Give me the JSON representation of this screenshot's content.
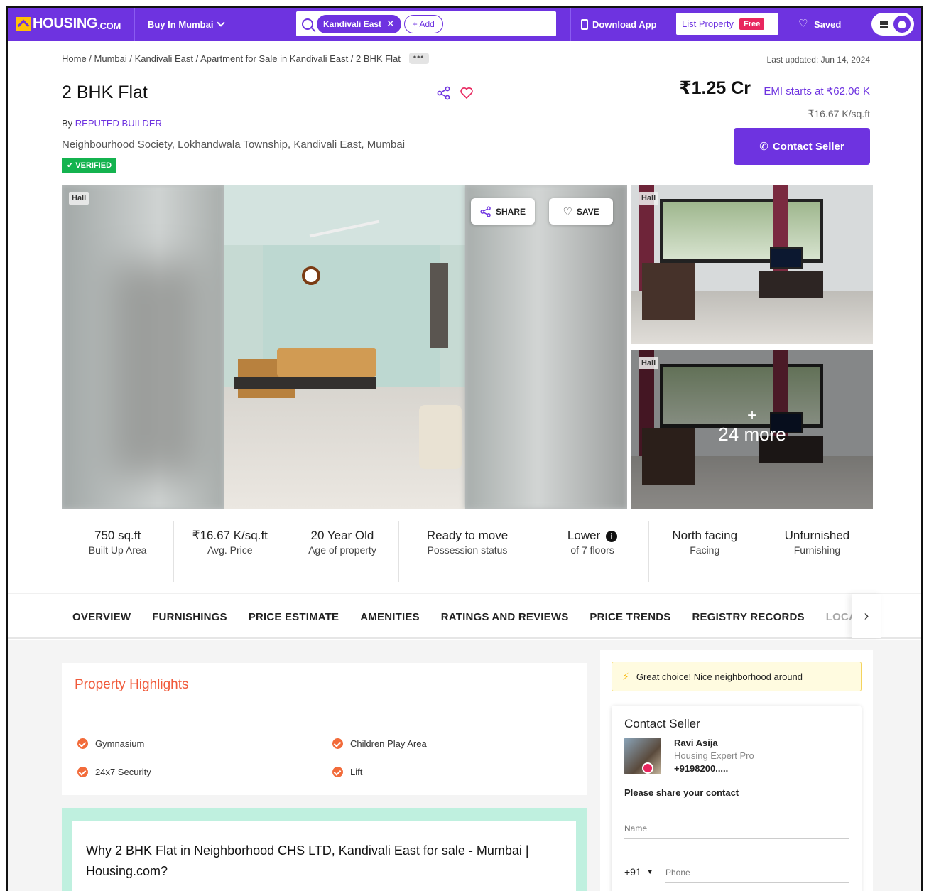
{
  "header": {
    "logo_text": "HOUSING",
    "logo_suffix": ".COM",
    "city_menu": "Buy In Mumbai",
    "search_chip": "Kandivali East",
    "add_chip": "+ Add",
    "download_app": "Download App",
    "list_property": "List Property",
    "free_badge": "Free",
    "saved": "Saved",
    "brand_color": "#6e33e0"
  },
  "breadcrumb": "Home / Mumbai / Kandivali East / Apartment for Sale in Kandivali East / 2 BHK Flat",
  "breadcrumb_more": "•••",
  "last_updated": "Last updated: Jun 14, 2024",
  "listing": {
    "title": "2 BHK Flat",
    "by_label": "By",
    "builder": "REPUTED BUILDER",
    "address": "Neighbourhood Society, Lokhandwala Township, Kandivali East, Mumbai",
    "verified": "VERIFIED",
    "price": "₹1.25 Cr",
    "emi": "EMI starts at ₹62.06 K",
    "price_per_sqft": "₹16.67 K/sq.ft",
    "contact_button": "Contact Seller"
  },
  "gallery": {
    "main_tag": "Hall",
    "share": "SHARE",
    "save": "SAVE",
    "side_tag_1": "Hall",
    "side_tag_2": "Hall",
    "more_plus": "+",
    "more_text": "24 more"
  },
  "stats": [
    {
      "value": "750 sq.ft",
      "label": "Built Up Area"
    },
    {
      "value": "₹16.67 K/sq.ft",
      "label": "Avg. Price"
    },
    {
      "value": "20 Year Old",
      "label": "Age of property"
    },
    {
      "value": "Ready to move",
      "label": "Possession status"
    },
    {
      "value": "Lower",
      "label": "of 7 floors"
    },
    {
      "value": "North facing",
      "label": "Facing"
    },
    {
      "value": "Unfurnished",
      "label": "Furnishing"
    }
  ],
  "tabs": [
    "OVERVIEW",
    "FURNISHINGS",
    "PRICE ESTIMATE",
    "AMENITIES",
    "RATINGS AND REVIEWS",
    "PRICE TRENDS",
    "REGISTRY RECORDS",
    "LOCALITY"
  ],
  "highlights": {
    "title": "Property Highlights",
    "items": [
      "Gymnasium",
      "Children Play Area",
      "24x7 Security",
      "Lift"
    ]
  },
  "why": {
    "heading": "Why 2 BHK Flat in Neighborhood CHS LTD, Kandivali East for sale - Mumbai | Housing.com?"
  },
  "sidebar": {
    "banner": "Great choice! Nice neighborhood around",
    "contact_title": "Contact Seller",
    "agent_name": "Ravi Asija",
    "agent_role": "Housing Expert Pro",
    "agent_phone": "+9198200.....",
    "share_prompt": "Please share your contact",
    "name_placeholder": "Name",
    "country_code": "+91",
    "phone_placeholder": "Phone"
  }
}
